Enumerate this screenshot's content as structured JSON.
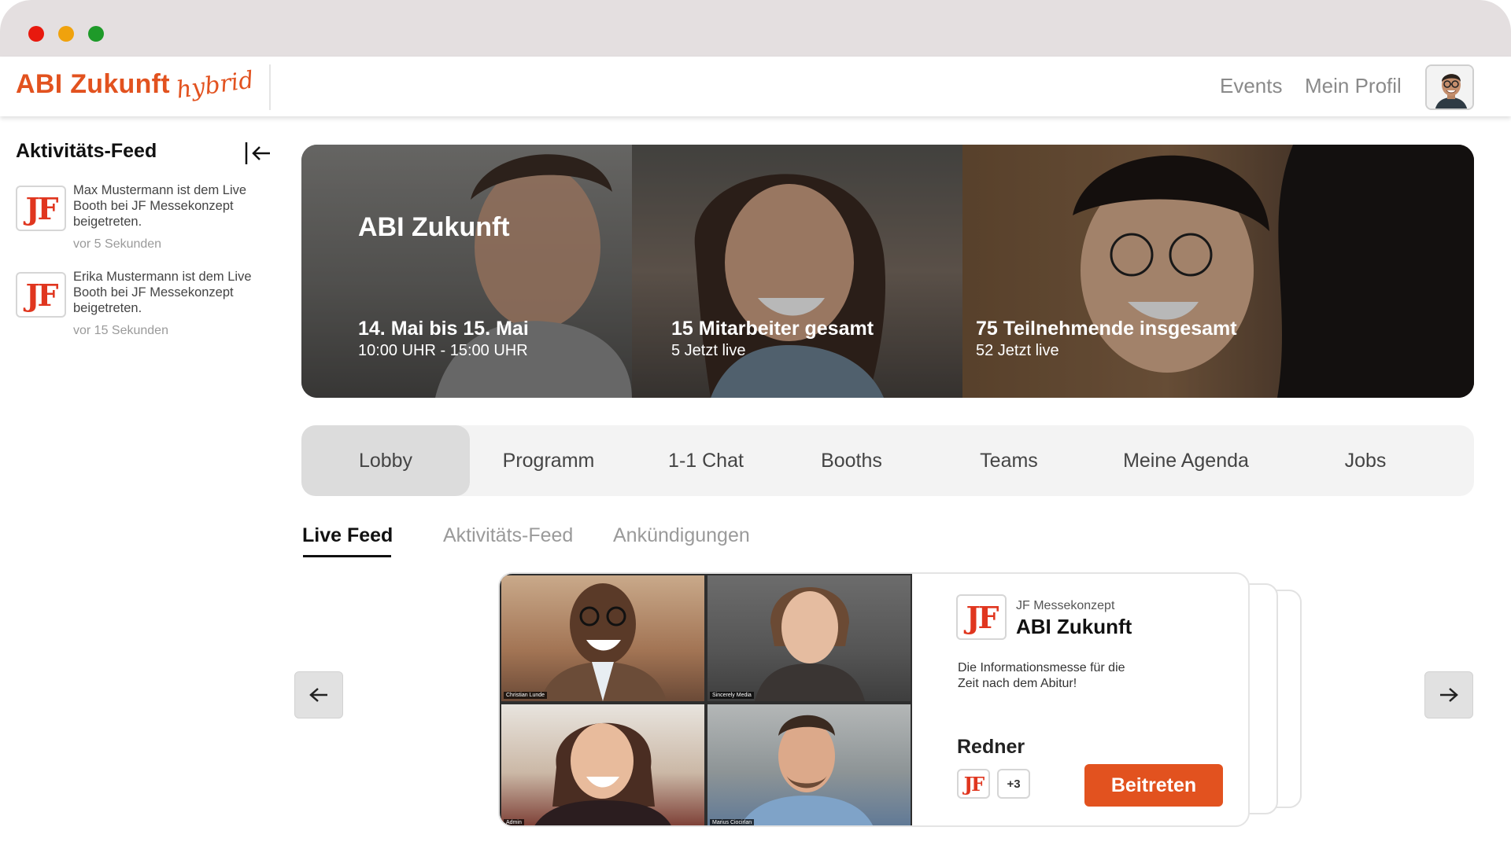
{
  "app": {
    "logo_main": "ABI Zukunft",
    "logo_sub": "hybrid",
    "accent_color": "#e2521f"
  },
  "header": {
    "nav": [
      {
        "label": "Events"
      },
      {
        "label": "Mein Profil"
      }
    ],
    "avatar_icon": "user-avatar"
  },
  "sidebar": {
    "title": "Aktivitäts-Feed",
    "collapse_icon": "collapse-left-icon",
    "items": [
      {
        "logo": "JF",
        "text": "Max Mustermann ist dem Live Booth bei JF Messekonzept beigetreten.",
        "time": "vor 5 Sekunden"
      },
      {
        "logo": "JF",
        "text": "Erika Mustermann ist dem Live Booth bei JF Messekonzept beigetreten.",
        "time": "vor 15 Sekunden"
      }
    ]
  },
  "banner": {
    "title": "ABI Zukunft",
    "stats": [
      {
        "big": "14. Mai bis 15. Mai",
        "small": "10:00 UHR - 15:00 UHR"
      },
      {
        "big": "15 Mitarbeiter gesamt",
        "small": "5 Jetzt live"
      },
      {
        "big": "75 Teilnehmende insgesamt",
        "small": "52 Jetzt live"
      }
    ]
  },
  "tabs": [
    {
      "label": "Lobby",
      "active": true
    },
    {
      "label": "Programm"
    },
    {
      "label": "1-1 Chat"
    },
    {
      "label": "Booths"
    },
    {
      "label": "Teams"
    },
    {
      "label": "Meine Agenda"
    },
    {
      "label": "Jobs"
    }
  ],
  "subtabs": [
    {
      "label": "Live Feed",
      "active": true
    },
    {
      "label": "Aktivitäts-Feed"
    },
    {
      "label": "Ankündigungen"
    }
  ],
  "card": {
    "video_tiles": [
      {
        "name": "Christian Lunde"
      },
      {
        "name": "Sincerely Media"
      },
      {
        "name": "Admin"
      },
      {
        "name": "Marius Ciocirlan"
      }
    ],
    "logo": "JF",
    "org": "JF Messekonzept",
    "event": "ABI Zukunft",
    "description": "Die Informationsmesse für die Zeit nach dem Abitur!",
    "speakers_title": "Redner",
    "speaker_logo": "JF",
    "speakers_more": "+3",
    "join_label": "Beitreten"
  }
}
